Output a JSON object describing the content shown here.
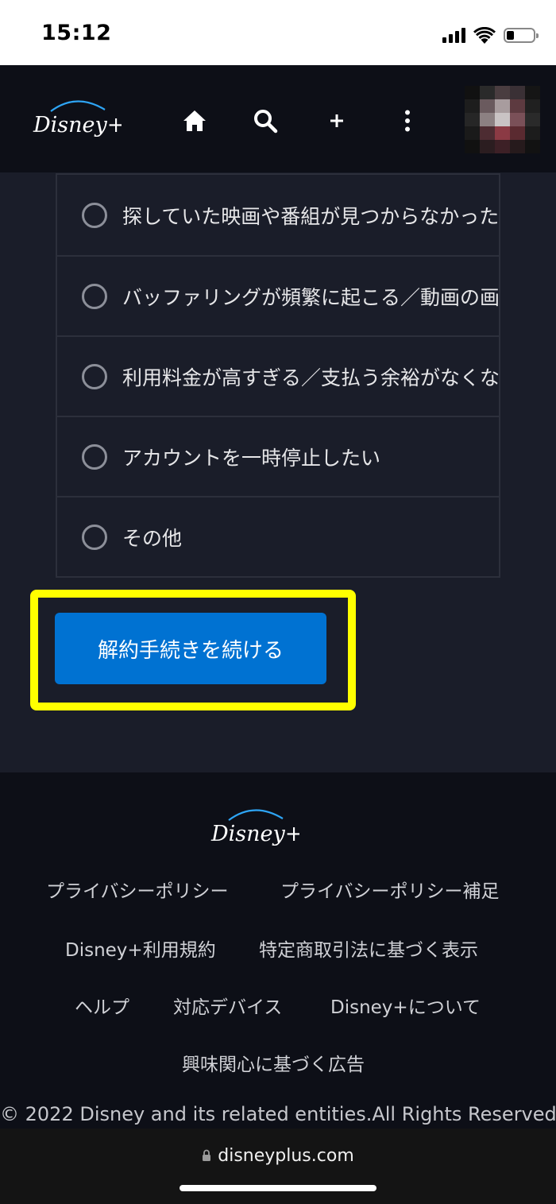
{
  "status_bar": {
    "time": "15:12"
  },
  "header": {
    "logo_text": "Disney+",
    "nav_icons": [
      "home-icon",
      "search-icon",
      "plus-icon",
      "more-vertical-icon"
    ]
  },
  "options": [
    {
      "label": "探していた映画や番組が見つからなかった"
    },
    {
      "label": "バッファリングが頻繁に起こる／動画の画質が"
    },
    {
      "label": "利用料金が高すぎる／支払う余裕がなくなった"
    },
    {
      "label": "アカウントを一時停止したい"
    },
    {
      "label": "その他"
    }
  ],
  "continue_button": {
    "label": "解約手続きを続ける",
    "color": "#0072d2",
    "highlight_color": "#ffff00"
  },
  "footer": {
    "logo_text": "Disney+",
    "links": {
      "privacy_policy": "プライバシーポリシー",
      "privacy_supplement": "プライバシーポリシー補足",
      "terms": "Disney+利用規約",
      "commercial_law": "特定商取引法に基づく表示",
      "help": "ヘルプ",
      "devices": "対応デバイス",
      "about": "Disney+について",
      "interest_ads": "興味関心に基づく広告"
    },
    "copyright": "© 2022 Disney and its related entities.All Rights Reserved."
  },
  "url_bar": {
    "url": "disneyplus.com"
  }
}
